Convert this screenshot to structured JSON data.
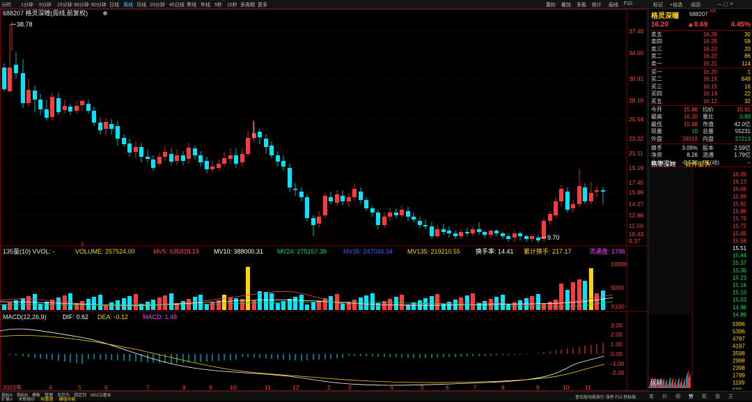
{
  "toolbar": {
    "timeframes": [
      "分时",
      "1分钟",
      "5分钟",
      "15分钟",
      "30分钟",
      "60分钟",
      "日线",
      "周线",
      "月线",
      "10分钟",
      "45日线",
      "季线",
      "年线",
      "5秒",
      "15秒",
      "多周期",
      "更多"
    ],
    "active_timeframe": "周线",
    "right_items": [
      "置权",
      "叠加",
      "多股",
      "统计",
      "画线",
      "F10",
      "标记",
      "+自选",
      "返回"
    ]
  },
  "chart": {
    "title": "688207 格灵深瞳(周线,前复权)",
    "high_label": "38.78",
    "low_label": "9.70",
    "price_axis": [
      "37.40",
      "34.00",
      "30.91",
      "28.10",
      "25.54",
      "23.22",
      "21.11",
      "19.19",
      "17.45",
      "15.86",
      "14.27",
      "12.86",
      "11.59",
      "10.43",
      "9.37"
    ],
    "date_labels": [
      "2023年",
      "4",
      "5",
      "6",
      "7",
      "8",
      "9",
      "10",
      "11",
      "12",
      "2",
      "3",
      "4",
      "5",
      "6",
      "7",
      "8",
      "9",
      "10",
      "11"
    ],
    "mark_3": "3"
  },
  "volume": {
    "title": "135量(10) VVOL: -",
    "legend": [
      {
        "text": "VOLUME: 257524.00",
        "color": "#ffd400"
      },
      {
        "text": "MV5: 535818.19",
        "color": "#ff4a4a"
      },
      {
        "text": "MV10: 388000.31",
        "color": "#ffffff"
      },
      {
        "text": "MV24: 275157.38",
        "color": "#00e05a"
      },
      {
        "text": "MV35: 247034.34",
        "color": "#3060ff"
      },
      {
        "text": "MV135: 219210.55",
        "color": "#ffd400"
      },
      {
        "text": "换手率: 14.41",
        "color": "#ffffff"
      },
      {
        "text": "累计换手: 217.17",
        "color": "#ffd400"
      },
      {
        "text": "流通盘: 1786",
        "color": "#ff40ff"
      }
    ],
    "axis": [
      "10000",
      "5000",
      "X100"
    ]
  },
  "macd": {
    "title": "MACD(12,26,9)",
    "dif": "DIF: 0.62",
    "dea": "DEA: -0.12",
    "macd": "MACD: 1.48",
    "axis": [
      "3.00",
      "2.00",
      "1.00",
      "0.00",
      "-1.00",
      "-2.00"
    ]
  },
  "quote": {
    "name": "格灵深瞳",
    "code": "688207",
    "kr": "KR",
    "price": "16.20",
    "change": "▲0.69",
    "pct": "4.45%",
    "asks": [
      {
        "label": "卖五",
        "price": "16.26",
        "vol": "30"
      },
      {
        "label": "卖四",
        "price": "16.25",
        "vol": "58"
      },
      {
        "label": "卖三",
        "price": "16.23",
        "vol": "20"
      },
      {
        "label": "卖二",
        "price": "16.22",
        "vol": "86"
      },
      {
        "label": "卖一",
        "price": "16.21",
        "vol": "114"
      }
    ],
    "bids": [
      {
        "label": "买一",
        "price": "16.20",
        "vol": "1"
      },
      {
        "label": "买二",
        "price": "16.19",
        "vol": "849"
      },
      {
        "label": "买三",
        "price": "16.15",
        "vol": "16"
      },
      {
        "label": "买四",
        "price": "16.14",
        "vol": "22"
      },
      {
        "label": "买五",
        "price": "16.12",
        "vol": "32"
      }
    ],
    "stats": [
      {
        "l1": "今开",
        "v1": "15.86",
        "c1": "red",
        "l2": "均价",
        "v2": "15.91",
        "c2": "red"
      },
      {
        "l1": "最高",
        "v1": "16.20",
        "c1": "red",
        "l2": "量比",
        "v2": "0.93",
        "c2": "grn"
      },
      {
        "l1": "最低",
        "v1": "15.68",
        "c1": "red",
        "l2": "市值",
        "v2": "42.0亿",
        "c2": "wht"
      },
      {
        "l1": "现量",
        "v1": "10",
        "c1": "grn",
        "l2": "总量",
        "v2": "55231",
        "c2": "wht"
      },
      {
        "l1": "外盘",
        "v1": "28018",
        "c1": "red",
        "l2": "内盘",
        "v2": "27213",
        "c2": "grn"
      }
    ],
    "stats2": [
      {
        "l1": "换手",
        "v1": "3.09%",
        "l2": "股本",
        "v2": "2.59亿"
      },
      {
        "l1": "净资",
        "v1": "8.26",
        "l2": "流通",
        "v2": "1.79亿"
      },
      {
        "l1": "收益(三)",
        "v1": "-0.530",
        "l2": "PE(动)",
        "v2": "--"
      }
    ],
    "mini_title": "格灵深瞳",
    "mini_service": "软件服务",
    "mini_axis": [
      "16.20",
      "16.13",
      "16.06",
      "15.99",
      "15.92",
      "15.86",
      "15.79",
      "15.72",
      "15.65",
      "15.58",
      "15.51",
      "15.44",
      "15.37",
      "15.30",
      "15.23",
      "15.16",
      "15.10",
      "15.03",
      "14.96",
      "14.89"
    ],
    "vol_axis": [
      "5996",
      "5396",
      "4797",
      "4197",
      "3598",
      "2998",
      "2398",
      "1799",
      "1199",
      "600"
    ],
    "mini_label": "固转",
    "tabs": [
      "笔",
      "价",
      "细",
      "势",
      "联",
      "值",
      "主"
    ]
  },
  "bottom": {
    "left_tabs": [
      "指标A",
      "指标B",
      "模板",
      "管理",
      "另存为",
      "锁定到",
      "MACD基本"
    ],
    "left_tabs2": [
      "扩展∧",
      "关联报价",
      "财富圈",
      "爆值功能"
    ],
    "right": "普及版功能指引 涨停 F10 剪贴板"
  }
}
